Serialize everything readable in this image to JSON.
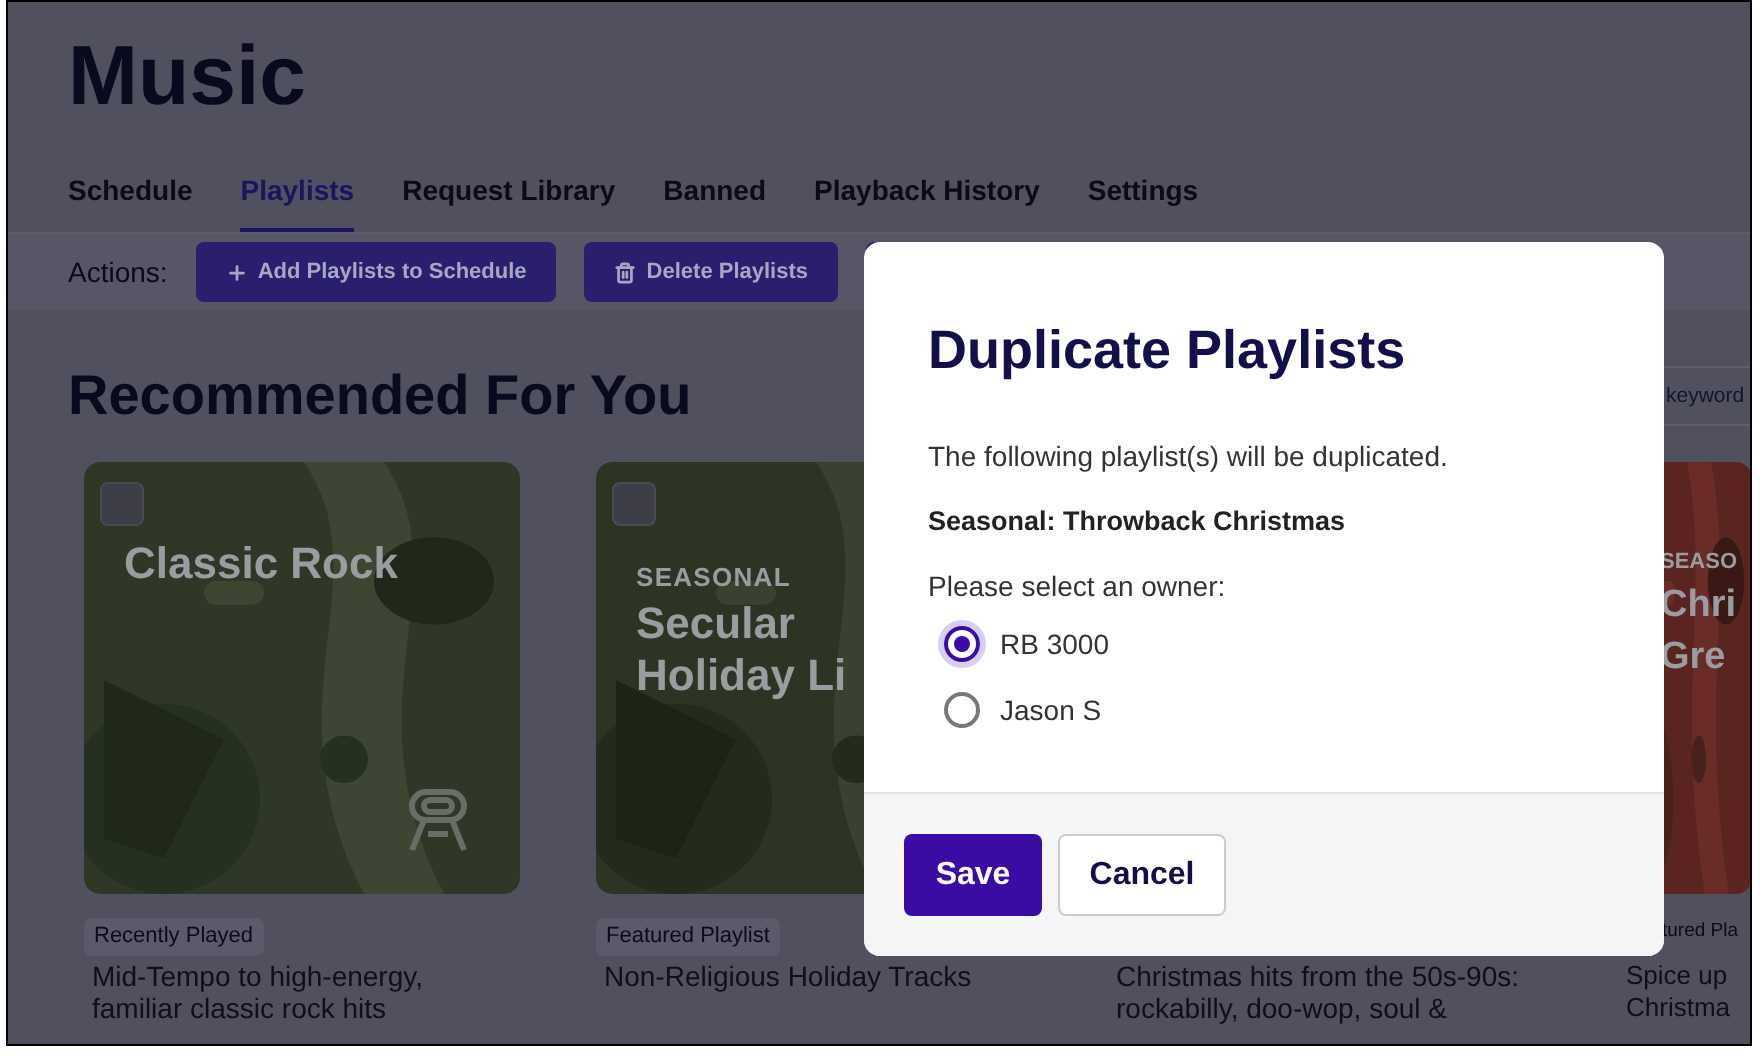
{
  "page": {
    "title": "Music",
    "tabs": [
      {
        "label": "Schedule",
        "selected": false
      },
      {
        "label": "Playlists",
        "selected": true
      },
      {
        "label": "Request Library",
        "selected": false
      },
      {
        "label": "Banned",
        "selected": false
      },
      {
        "label": "Playback History",
        "selected": false
      },
      {
        "label": "Settings",
        "selected": false
      }
    ],
    "actions_label": "Actions:",
    "actions": [
      {
        "kind": "add",
        "label": "Add Playlists to Schedule"
      },
      {
        "kind": "delete",
        "label": "Delete Playlists"
      },
      {
        "kind": "covered"
      }
    ],
    "section_title": "Recommended For You",
    "search": {
      "placeholder": "keyword"
    },
    "cards": [
      {
        "kind": "full",
        "checked": false,
        "title": "Classic Rock",
        "tag": "Recently Played",
        "description": "Mid-Tempo to high-energy, familiar classic rock hits"
      },
      {
        "kind": "partial",
        "checked": false,
        "eyebrow": "SEASONAL",
        "title": "Secular Holiday Li",
        "tag": "Featured Playlist",
        "description": "Non-Religious Holiday Tracks"
      },
      {
        "kind": "covered",
        "description": "Christmas hits from the 50s-90s: rockabilly, doo-wop, soul &"
      },
      {
        "kind": "edge",
        "eyebrow": "SEASO",
        "title": "Chri Gre",
        "tag": "tured Pla",
        "description": "Spice up Christma"
      }
    ]
  },
  "dialog": {
    "title": "Duplicate Playlists",
    "message": "The following playlist(s) will be duplicated.",
    "playlist": "Seasonal: Throwback Christmas",
    "owner_prompt": "Please select an owner:",
    "owners": [
      {
        "label": "RB 3000",
        "selected": true
      },
      {
        "label": "Jason S",
        "selected": false
      }
    ],
    "buttons": [
      {
        "kind": "primary",
        "label": "Save"
      },
      {
        "kind": "secondary",
        "label": "Cancel"
      }
    ]
  }
}
